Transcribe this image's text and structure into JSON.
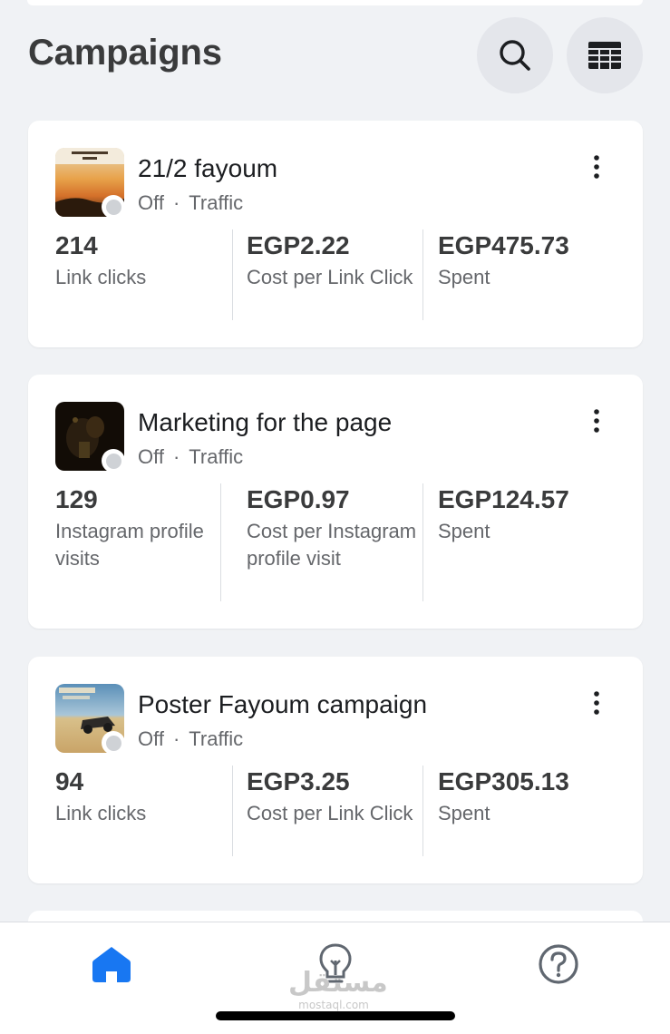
{
  "header": {
    "title": "Campaigns",
    "search_icon": "search-icon",
    "table_icon": "table-view-icon"
  },
  "campaigns": [
    {
      "name": "21/2 fayoum",
      "status": "Off",
      "objective": "Traffic",
      "thumbnail": "sunset-desert-thumbnail",
      "metrics": [
        {
          "value": "214",
          "label": "Link clicks"
        },
        {
          "value": "EGP2.22",
          "label": "Cost per Link Click"
        },
        {
          "value": "EGP475.73",
          "label": "Spent"
        }
      ]
    },
    {
      "name": "Marketing for the page",
      "status": "Off",
      "objective": "Traffic",
      "thumbnail": "dark-night-thumbnail",
      "metrics": [
        {
          "value": "129",
          "label": "Instagram profile visits"
        },
        {
          "value": "EGP0.97",
          "label": "Cost per Instagram profile visit"
        },
        {
          "value": "EGP124.57",
          "label": "Spent"
        }
      ]
    },
    {
      "name": "Poster Fayoum campaign",
      "status": "Off",
      "objective": "Traffic",
      "thumbnail": "poster-desert-thumbnail",
      "metrics": [
        {
          "value": "94",
          "label": "Link clicks"
        },
        {
          "value": "EGP3.25",
          "label": "Cost per Link Click"
        },
        {
          "value": "EGP305.13",
          "label": "Spent"
        }
      ]
    }
  ],
  "bottom_nav": {
    "home_icon": "home-icon",
    "ideas_icon": "lightbulb-icon",
    "help_icon": "help-icon",
    "watermark_arabic": "مستقل",
    "watermark_latin": "mostaql.com"
  },
  "colors": {
    "accent": "#1877f2",
    "background": "#f0f2f5",
    "card": "#ffffff",
    "muted_text": "#65676b",
    "status_off": "#cfd2d6"
  }
}
